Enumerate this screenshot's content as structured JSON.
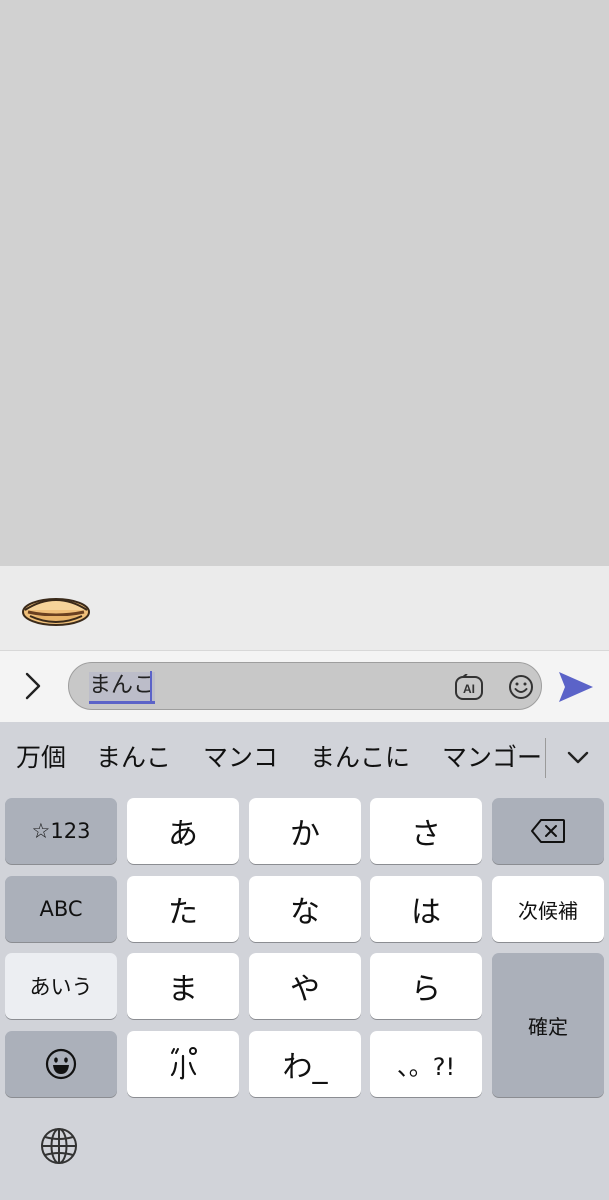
{
  "input": {
    "value": "まんこ"
  },
  "suggestions": [
    "万個",
    "まんこ",
    "マンコ",
    "まんこに",
    "マンゴー"
  ],
  "keys": {
    "symbols": "☆123",
    "a": "あ",
    "ka": "か",
    "sa": "さ",
    "abc": "ABC",
    "ta": "た",
    "na": "な",
    "ha": "は",
    "next_candidate": "次候補",
    "aiu": "あいう",
    "ma": "ま",
    "ya": "や",
    "ra": "ら",
    "confirm": "確定",
    "wa": "わ_",
    "punct": "、。?!"
  },
  "icons": {
    "expand": "chevron-right-icon",
    "ai": "ai-icon",
    "emoji": "smiley-icon",
    "send": "send-icon",
    "delete": "backspace-icon",
    "collapse": "chevron-down-icon",
    "emoji_key": "grinning-face-icon",
    "globe": "globe-icon",
    "dakuten": "dakuten-small-icon",
    "sticker": "dorayaki-sticker"
  },
  "colors": {
    "accent": "#5b63c8",
    "keyboard_bg": "#d1d3d9",
    "key_white": "#ffffff",
    "key_gray": "#abb0ba"
  }
}
